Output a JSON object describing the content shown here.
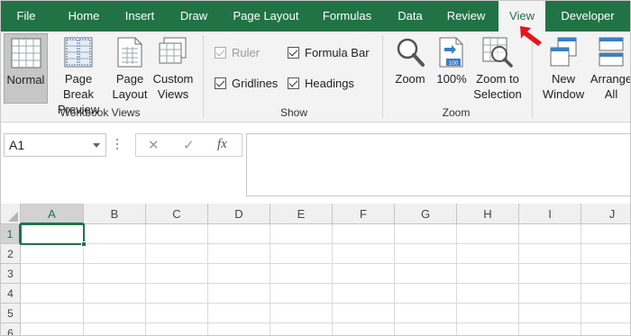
{
  "tabs": [
    {
      "label": "File",
      "active": false
    },
    {
      "label": "Home",
      "active": false
    },
    {
      "label": "Insert",
      "active": false
    },
    {
      "label": "Draw",
      "active": false
    },
    {
      "label": "Page Layout",
      "active": false
    },
    {
      "label": "Formulas",
      "active": false
    },
    {
      "label": "Data",
      "active": false
    },
    {
      "label": "Review",
      "active": false
    },
    {
      "label": "View",
      "active": true
    },
    {
      "label": "Developer",
      "active": false
    }
  ],
  "ribbon": {
    "workbook_views": {
      "group_label": "Workbook Views",
      "normal": {
        "line1": "Normal",
        "line2": ""
      },
      "page_break": {
        "line1": "Page Break",
        "line2": "Preview"
      },
      "page_layout": {
        "line1": "Page",
        "line2": "Layout"
      },
      "custom_views": {
        "line1": "Custom",
        "line2": "Views"
      }
    },
    "show": {
      "group_label": "Show",
      "ruler": {
        "label": "Ruler",
        "checked": true,
        "disabled": true
      },
      "formula_bar": {
        "label": "Formula Bar",
        "checked": true
      },
      "gridlines": {
        "label": "Gridlines",
        "checked": true
      },
      "headings": {
        "label": "Headings",
        "checked": true
      }
    },
    "zoom": {
      "group_label": "Zoom",
      "zoom": {
        "line1": "Zoom",
        "line2": ""
      },
      "hundred": {
        "line1": "100%",
        "line2": ""
      },
      "zoom_to_selection": {
        "line1": "Zoom to",
        "line2": "Selection"
      }
    },
    "window": {
      "new_window": {
        "line1": "New",
        "line2": "Window"
      },
      "arrange_all": {
        "line1": "Arrange",
        "line2": "All"
      }
    }
  },
  "formula_bar": {
    "name_box": "A1",
    "cancel_glyph": "✕",
    "enter_glyph": "✓",
    "fx_glyph": "fx",
    "value": ""
  },
  "sheet": {
    "columns": [
      "A",
      "B",
      "C",
      "D",
      "E",
      "F",
      "G",
      "H",
      "I",
      "J"
    ],
    "rows": [
      "1",
      "2",
      "3",
      "4",
      "5",
      "6"
    ],
    "active_cell": "A1"
  },
  "colors": {
    "accent": "#217346",
    "arrow": "#e8141b"
  }
}
